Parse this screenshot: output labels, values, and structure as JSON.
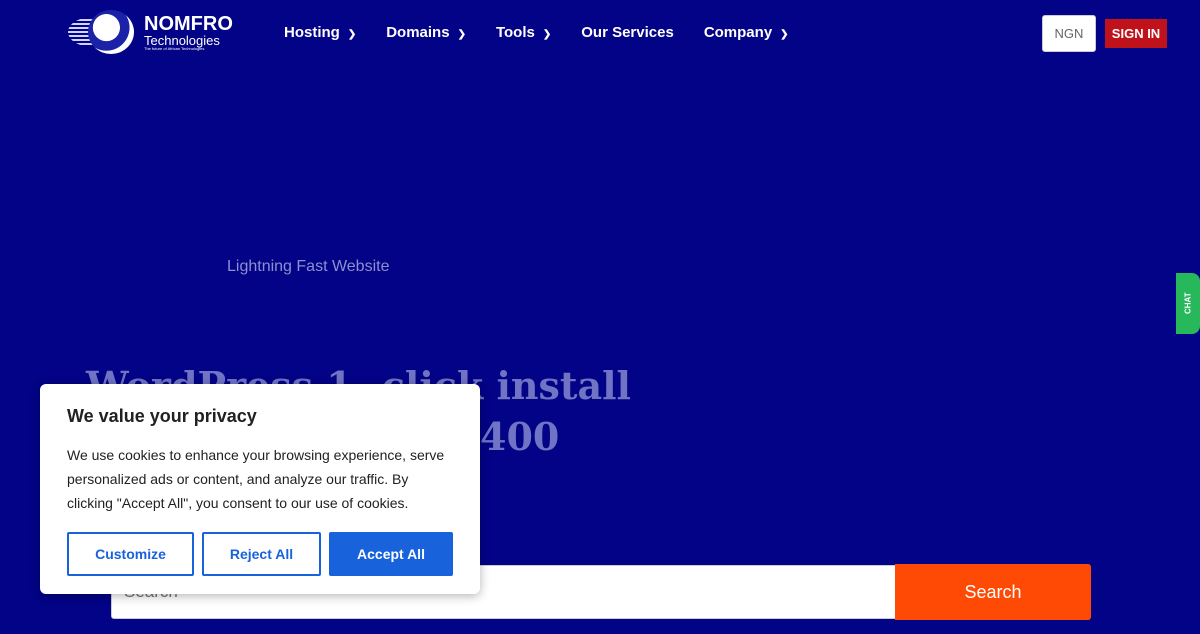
{
  "header": {
    "brand": "NOMFRO",
    "brand_sub": "Technologies",
    "tagline": "The future of African Technologies",
    "nav": [
      "Hosting",
      "Domains",
      "Tools",
      "Our Services",
      "Company"
    ],
    "currency": "NGN",
    "sign_in": "SIGN IN"
  },
  "hero": {
    "subtitle": "Lightning Fast Website",
    "title_line1": "WordPress 1- click install",
    "title_line2_fragment": "400"
  },
  "search": {
    "placeholder": "Search",
    "button": "Search"
  },
  "chat": {
    "label": "CHAT",
    "color": "#27b85c"
  },
  "cookie": {
    "title": "We value your privacy",
    "text": "We use cookies to enhance your browsing experience, serve personalized ads or content, and analyze our traffic. By clicking \"Accept All\", you consent to our use of cookies.",
    "customize": "Customize",
    "reject": "Reject All",
    "accept": "Accept All"
  },
  "colors": {
    "background": "#020386",
    "sign_in": "#c0121a",
    "search_button": "#ff4a05",
    "accent": "#1863dc"
  }
}
